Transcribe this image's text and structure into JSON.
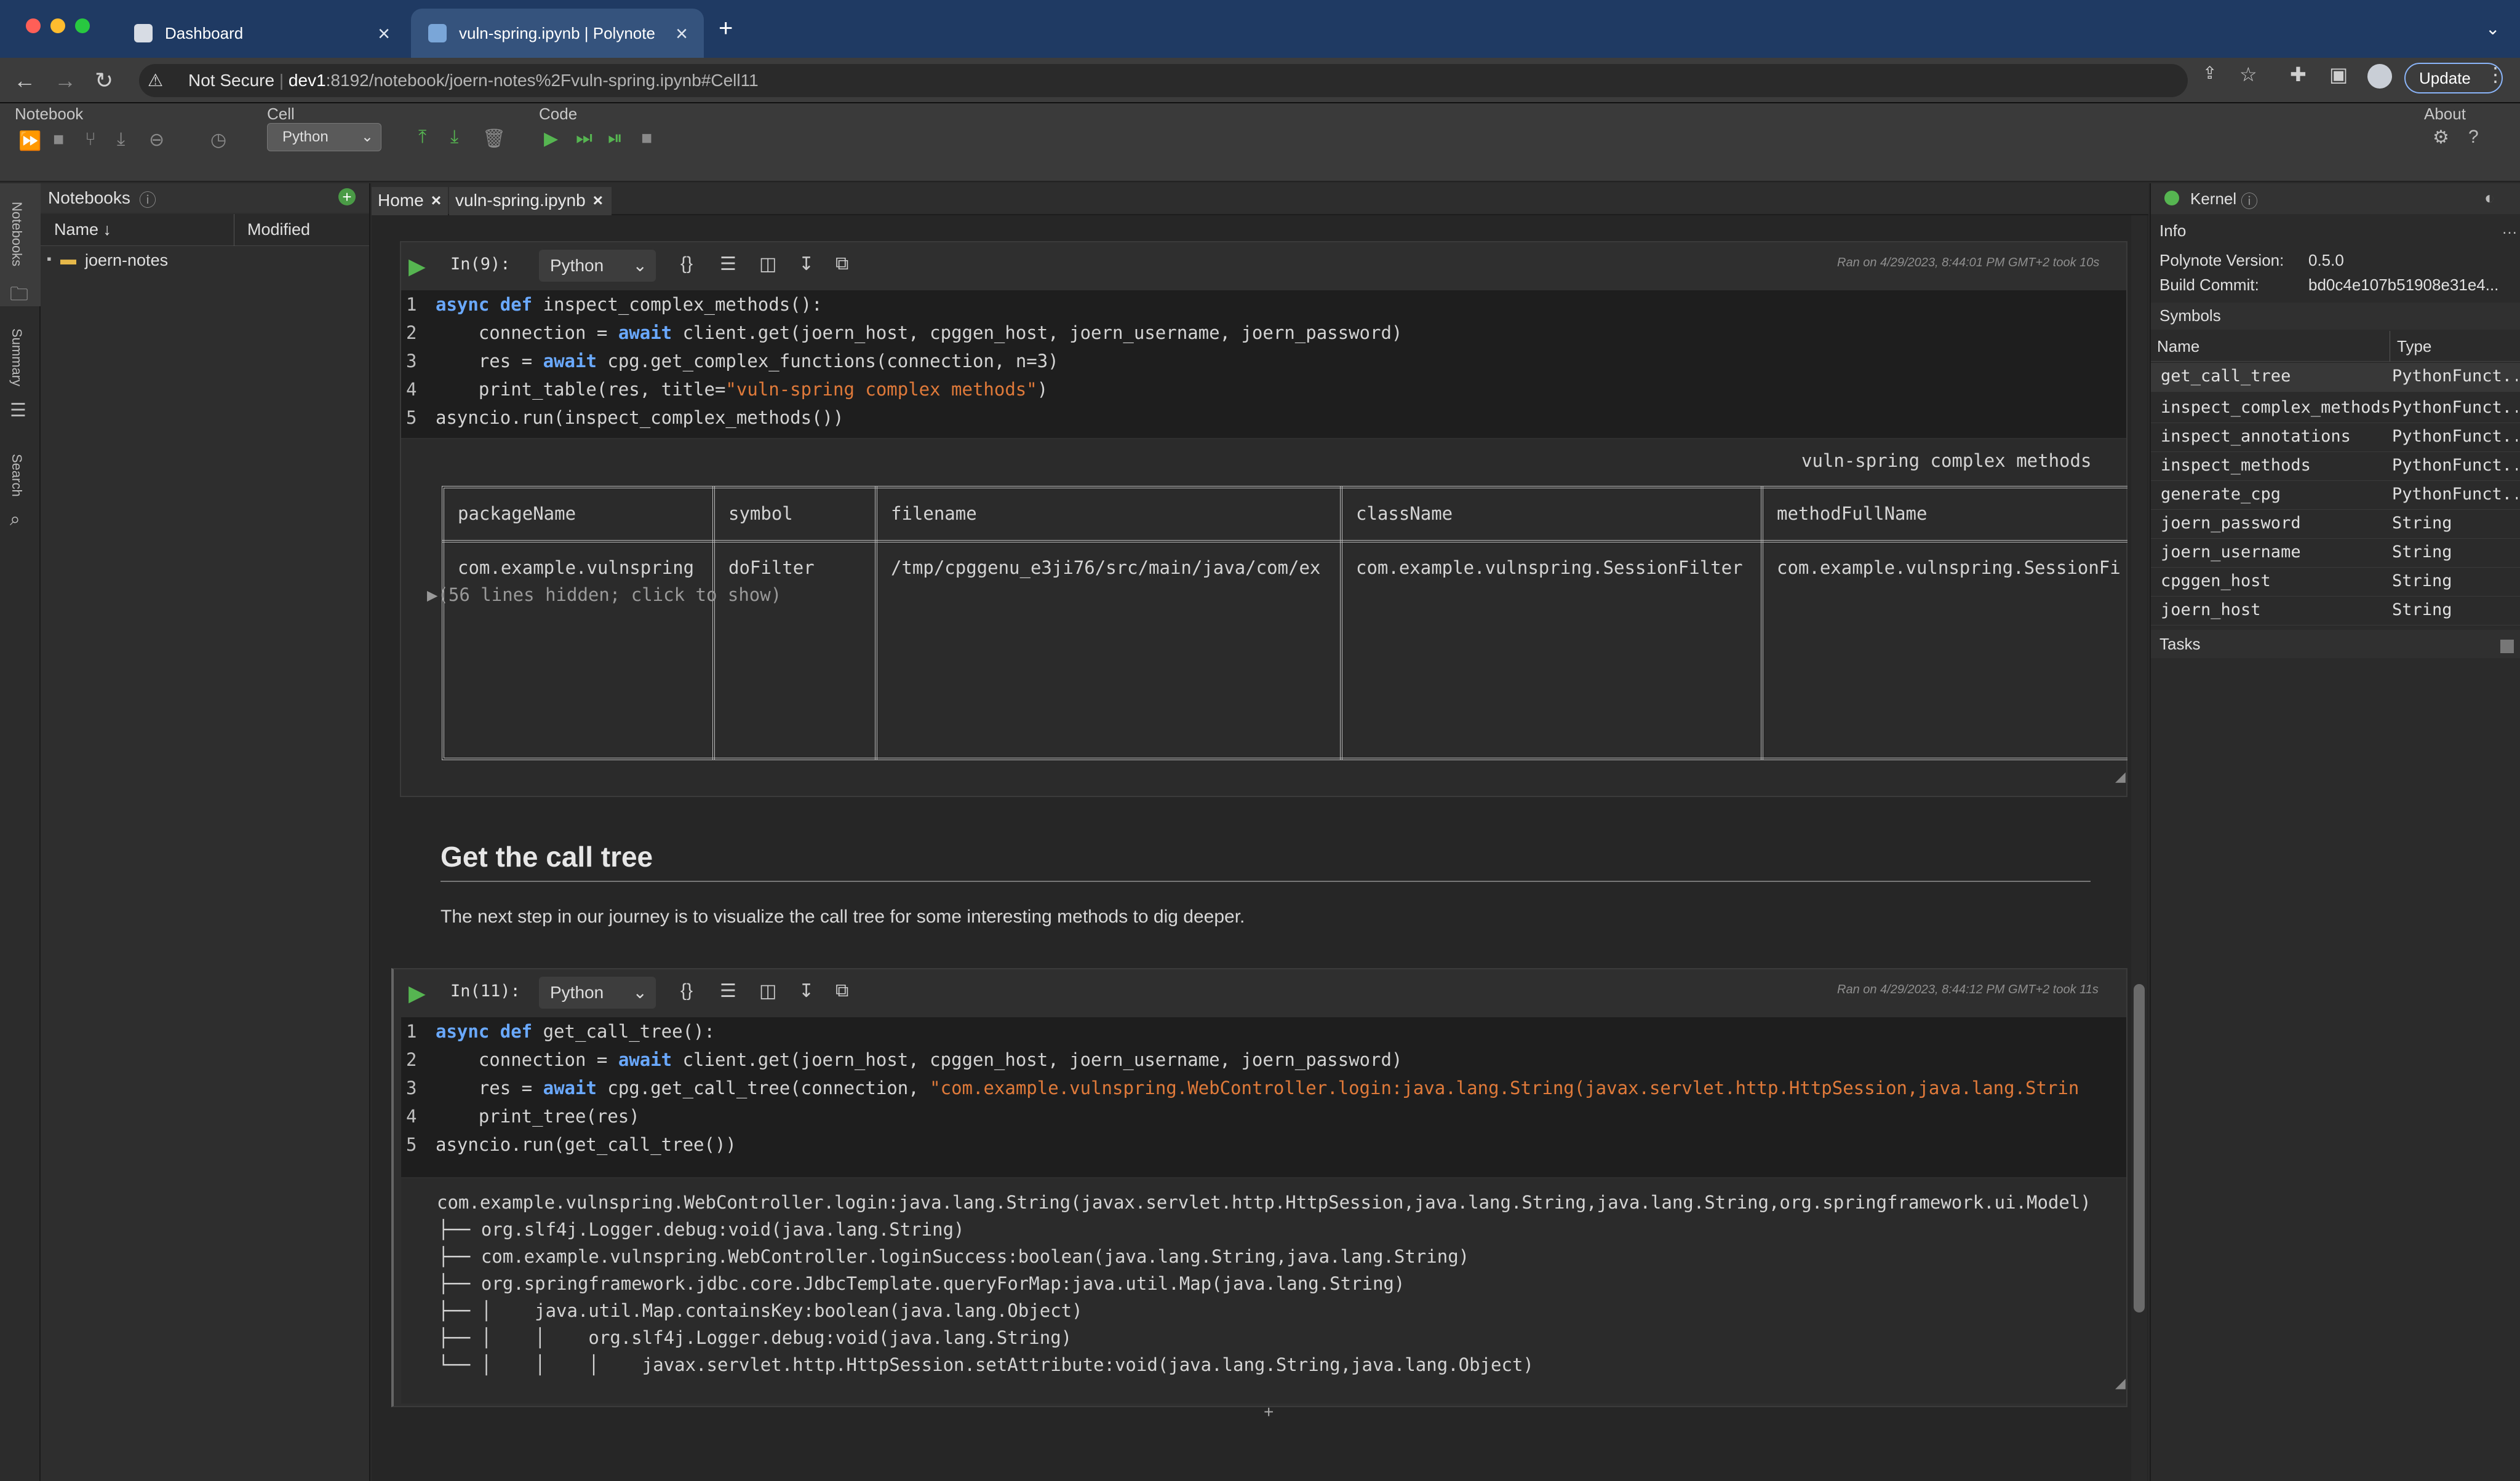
{
  "browser": {
    "tabs": [
      {
        "title": "Dashboard"
      },
      {
        "title": "vuln-spring.ipynb | Polynote"
      }
    ],
    "address": {
      "security": "Not Secure",
      "host": "dev1",
      "path": ":8192/notebook/joern-notes%2Fvuln-spring.ipynb#Cell11"
    },
    "update_label": "Update"
  },
  "toolbar": {
    "notebook_label": "Notebook",
    "cell_label": "Cell",
    "cell_type": "Python",
    "code_label": "Code",
    "about_label": "About"
  },
  "rail": {
    "notebooks": "Notebooks",
    "summary": "Summary",
    "search": "Search"
  },
  "notebooks_panel": {
    "title": "Notebooks",
    "col_name": "Name ↓",
    "col_modified": "Modified",
    "tree": [
      {
        "name": "joern-notes"
      }
    ]
  },
  "notebook_tabs": [
    {
      "label": "Home"
    },
    {
      "label": "vuln-spring.ipynb"
    }
  ],
  "cell9": {
    "prompt": "In(9):",
    "language": "Python",
    "ran": "Ran on 4/29/2023, 8:44:01 PM GMT+2 took 10s",
    "lines": [
      {
        "n": "1",
        "a": "",
        "k1": "async def",
        "b": " inspect_complex_methods():",
        "k2": "",
        "c": "",
        "s": "",
        "d": ""
      },
      {
        "n": "2",
        "a": "    connection = ",
        "k1": "await",
        "b": " client.get(joern_host, cpggen_host, joern_username, joern_password)",
        "k2": "",
        "c": "",
        "s": "",
        "d": ""
      },
      {
        "n": "3",
        "a": "    res = ",
        "k1": "await",
        "b": " cpg.get_complex_functions(connection, n=3)",
        "k2": "",
        "c": "",
        "s": "",
        "d": ""
      },
      {
        "n": "4",
        "a": "    print_table(res, title=",
        "k1": "",
        "b": "",
        "k2": "",
        "c": "",
        "s": "\"vuln-spring complex methods\"",
        "d": ")"
      },
      {
        "n": "5",
        "a": "asyncio.run(inspect_complex_methods())",
        "k1": "",
        "b": "",
        "k2": "",
        "c": "",
        "s": "",
        "d": ""
      }
    ],
    "table": {
      "title": "vuln-spring complex methods",
      "headers": [
        "packageName",
        "symbol",
        "filename",
        "className",
        "methodFullName"
      ],
      "row": [
        "com.example.vulnspring",
        "doFilter",
        "/tmp/cpggenu_e3ji76/src/main/java/com/ex",
        "com.example.vulnspring.SessionFilter",
        "com.example.vulnspring.SessionFi"
      ],
      "hidden": "(56 lines hidden; click to show)"
    }
  },
  "markdown": {
    "heading": "Get the call tree",
    "para": "The next step in our journey is to visualize the call tree for some interesting methods to dig deeper."
  },
  "cell11": {
    "prompt": "In(11):",
    "language": "Python",
    "ran": "Ran on 4/29/2023, 8:44:12 PM GMT+2 took 11s",
    "lines": [
      {
        "n": "1",
        "a": "",
        "k1": "async def",
        "b": " get_call_tree():",
        "s": "",
        "d": ""
      },
      {
        "n": "2",
        "a": "    connection = ",
        "k1": "await",
        "b": " client.get(joern_host, cpggen_host, joern_username, joern_password)",
        "s": "",
        "d": ""
      },
      {
        "n": "3",
        "a": "    res = ",
        "k1": "await",
        "b": " cpg.get_call_tree(connection, ",
        "s": "\"com.example.vulnspring.WebController.login:java.lang.String(javax.servlet.http.HttpSession,java.lang.Strin",
        "d": ""
      },
      {
        "n": "4",
        "a": "    print_tree(res)",
        "k1": "",
        "b": "",
        "s": "",
        "d": ""
      },
      {
        "n": "5",
        "a": "asyncio.run(get_call_tree())",
        "k1": "",
        "b": "",
        "s": "",
        "d": ""
      }
    ],
    "output": [
      "com.example.vulnspring.WebController.login:java.lang.String(javax.servlet.http.HttpSession,java.lang.String,java.lang.String,org.springframework.ui.Model)",
      "├── org.slf4j.Logger.debug:void(java.lang.String)",
      "├── com.example.vulnspring.WebController.loginSuccess:boolean(java.lang.String,java.lang.String)",
      "├── org.springframework.jdbc.core.JdbcTemplate.queryForMap:java.util.Map(java.lang.String)",
      "├── │    java.util.Map.containsKey:boolean(java.lang.Object)",
      "├── │    │    org.slf4j.Logger.debug:void(java.lang.String)",
      "└── │    │    │    javax.servlet.http.HttpSession.setAttribute:void(java.lang.String,java.lang.Object)"
    ]
  },
  "kernel": {
    "title": "Kernel",
    "info_label": "Info",
    "version_label": "Polynote Version:",
    "version": "0.5.0",
    "commit_label": "Build Commit:",
    "commit": "bd0c4e107b51908e31e4...",
    "symbols_label": "Symbols",
    "col_name": "Name",
    "col_type": "Type",
    "symbols": [
      {
        "name": "get_call_tree",
        "type": "PythonFunct..."
      },
      {
        "name": "inspect_complex_methods",
        "type": "PythonFunct..."
      },
      {
        "name": "inspect_annotations",
        "type": "PythonFunct..."
      },
      {
        "name": "inspect_methods",
        "type": "PythonFunct..."
      },
      {
        "name": "generate_cpg",
        "type": "PythonFunct..."
      },
      {
        "name": "joern_password",
        "type": "String"
      },
      {
        "name": "joern_username",
        "type": "String"
      },
      {
        "name": "cpggen_host",
        "type": "String"
      },
      {
        "name": "joern_host",
        "type": "String"
      }
    ],
    "tasks_label": "Tasks"
  },
  "add_cell": "+"
}
